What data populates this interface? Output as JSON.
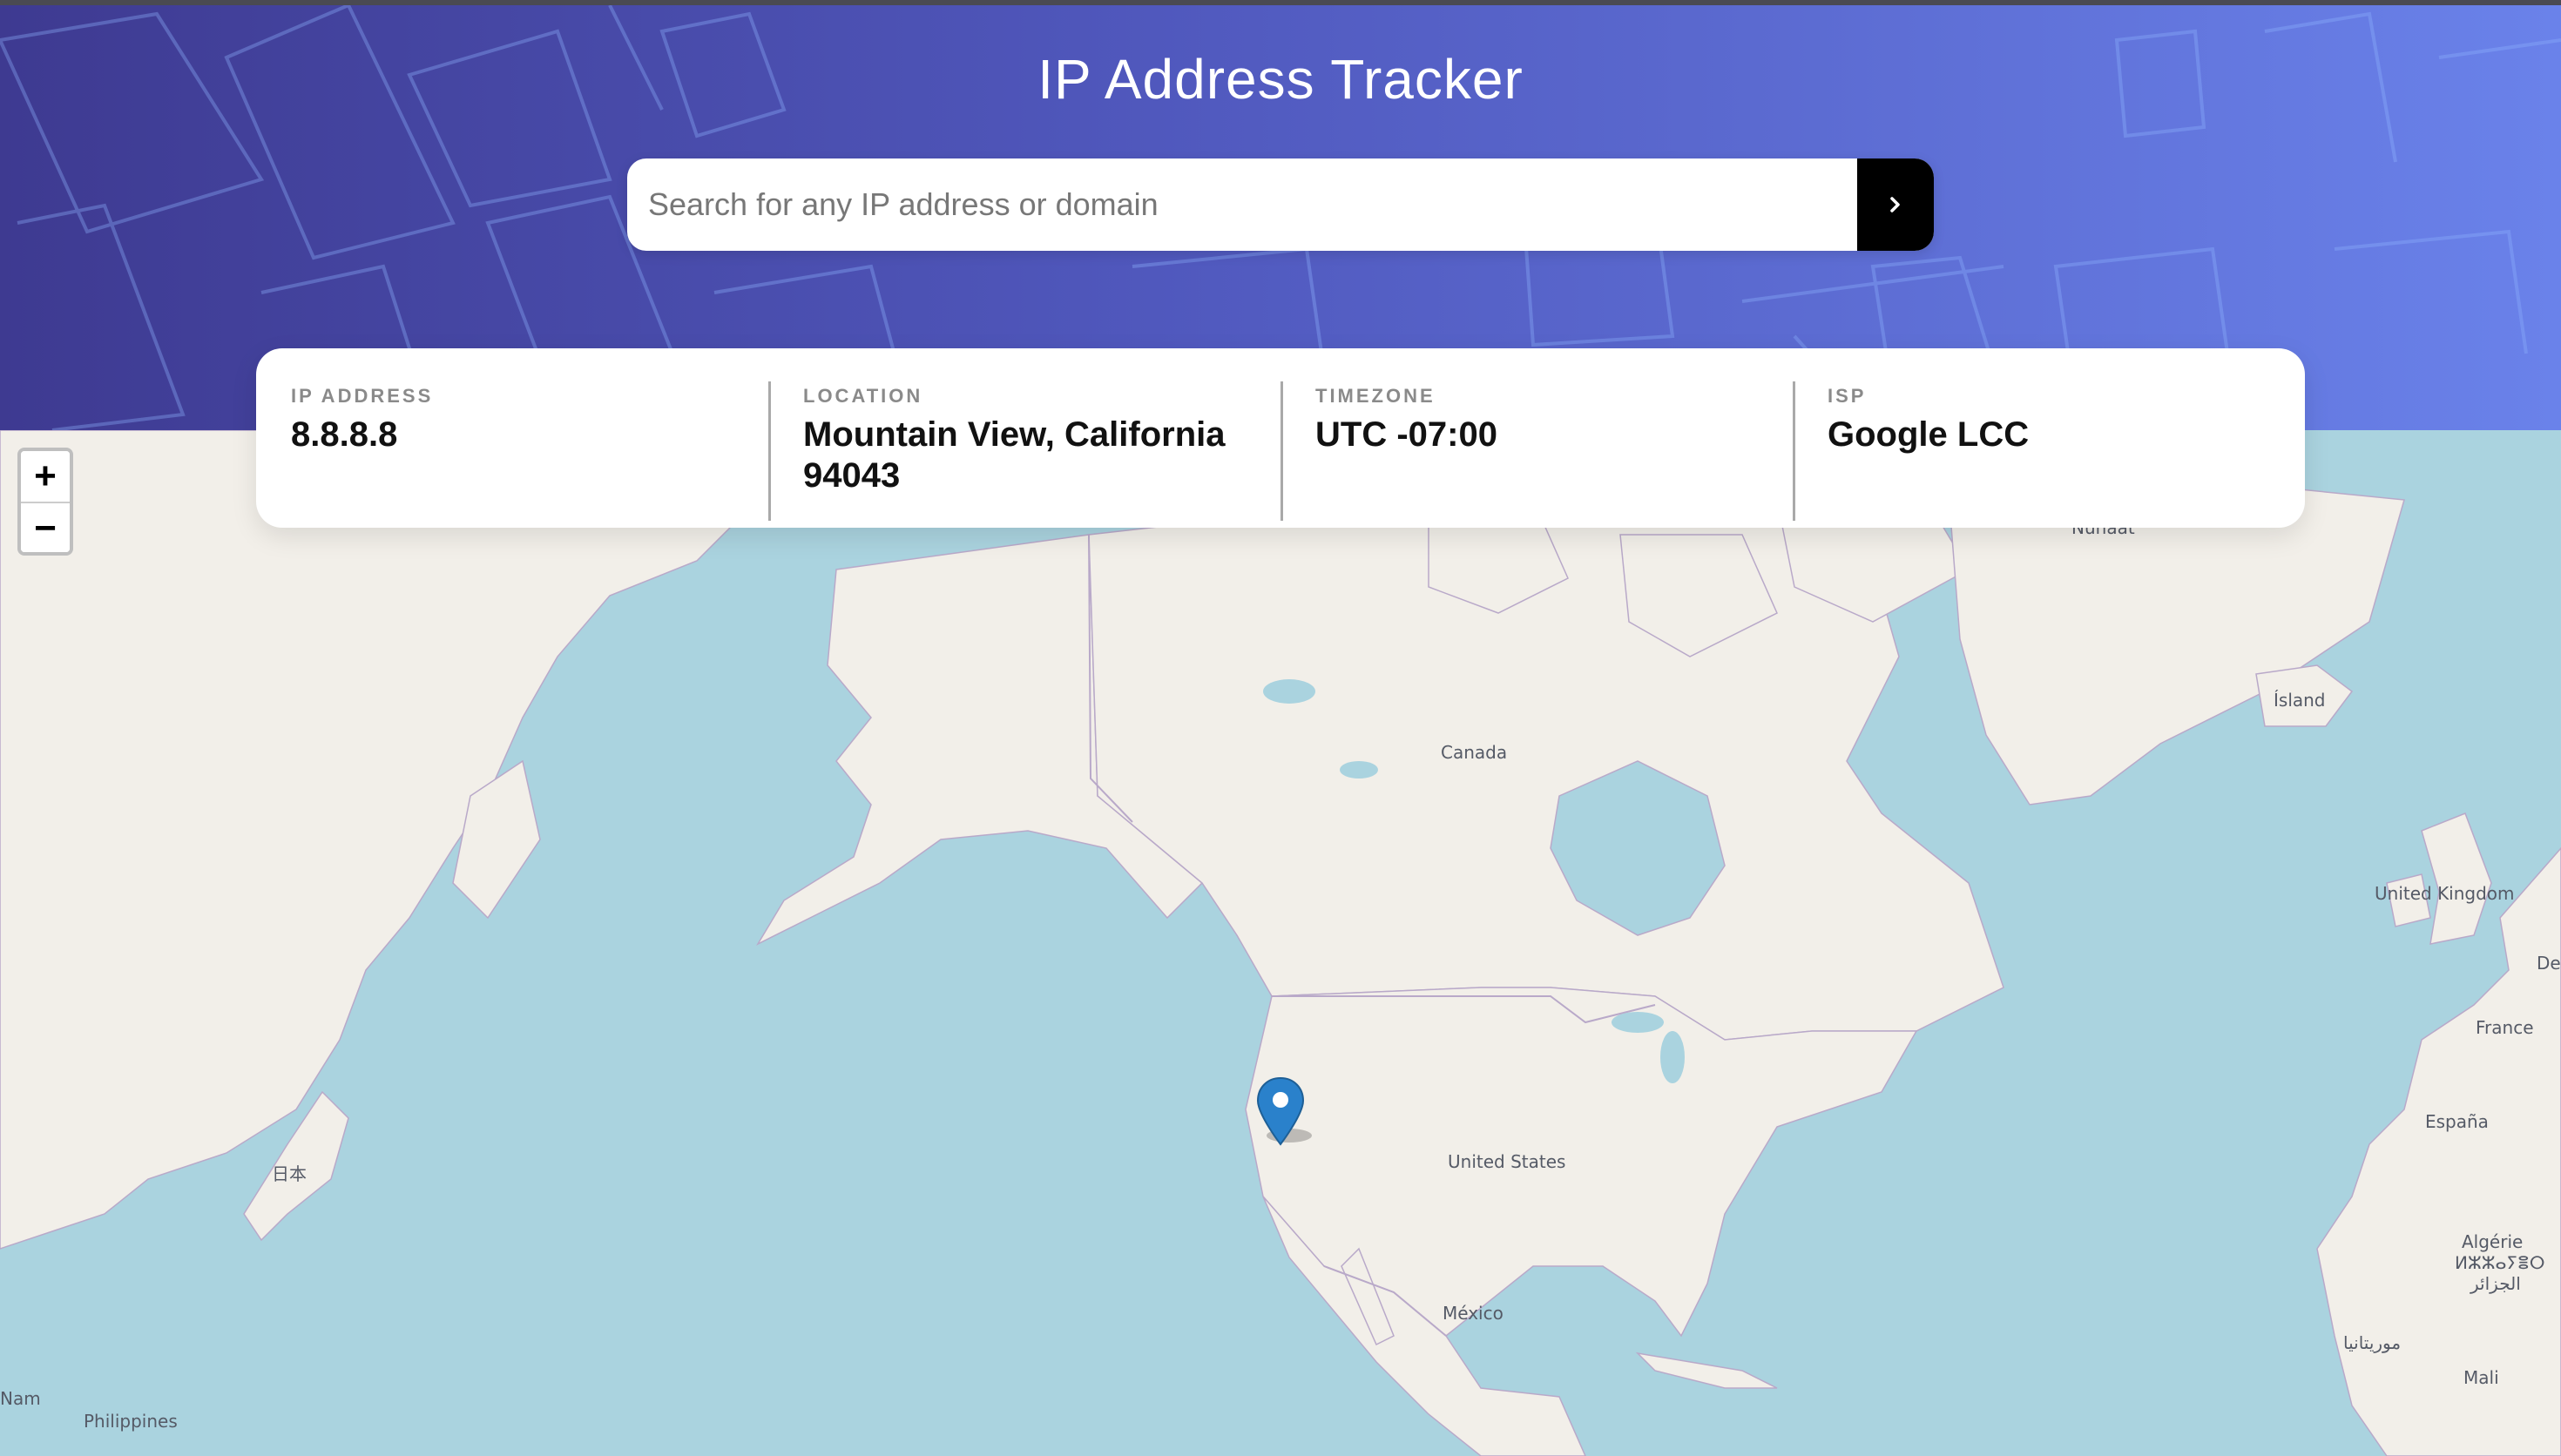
{
  "header": {
    "title": "IP Address Tracker",
    "search_placeholder": "Search for any IP address or domain",
    "search_button_icon": "chevron-right-icon"
  },
  "info": {
    "ip_label": "IP ADDRESS",
    "ip_value": "8.8.8.8",
    "location_label": "LOCATION",
    "location_value": "Mountain View, California 94043",
    "timezone_label": "TIMEZONE",
    "timezone_value": "UTC -07:00",
    "isp_label": "ISP",
    "isp_value": "Google LCC"
  },
  "map": {
    "zoom_in": "+",
    "zoom_out": "−",
    "marker_icon": "map-pin-icon",
    "labels": {
      "canada": "Canada",
      "united_states": "United States",
      "mexico": "México",
      "island": "Ísland",
      "united_kingdom": "United Kingdom",
      "france": "France",
      "espana": "España",
      "algerie": "Algérie",
      "algerie_tifinagh": "ⵍⵣⵣⴰⵢⴻⵔ",
      "algerie_arabic": "الجزائر",
      "mauritanie_arabic": "موريتانيا",
      "mali": "Mali",
      "japan": "日本",
      "philippines": "Philippines",
      "nam": "Nam",
      "kalaallit": "Nunaat",
      "de": "De"
    }
  },
  "colors": {
    "header_start": "#3e3a91",
    "header_end": "#6a82ea",
    "water": "#aad3df",
    "land": "#f2efe9",
    "marker": "#2a81cb"
  }
}
